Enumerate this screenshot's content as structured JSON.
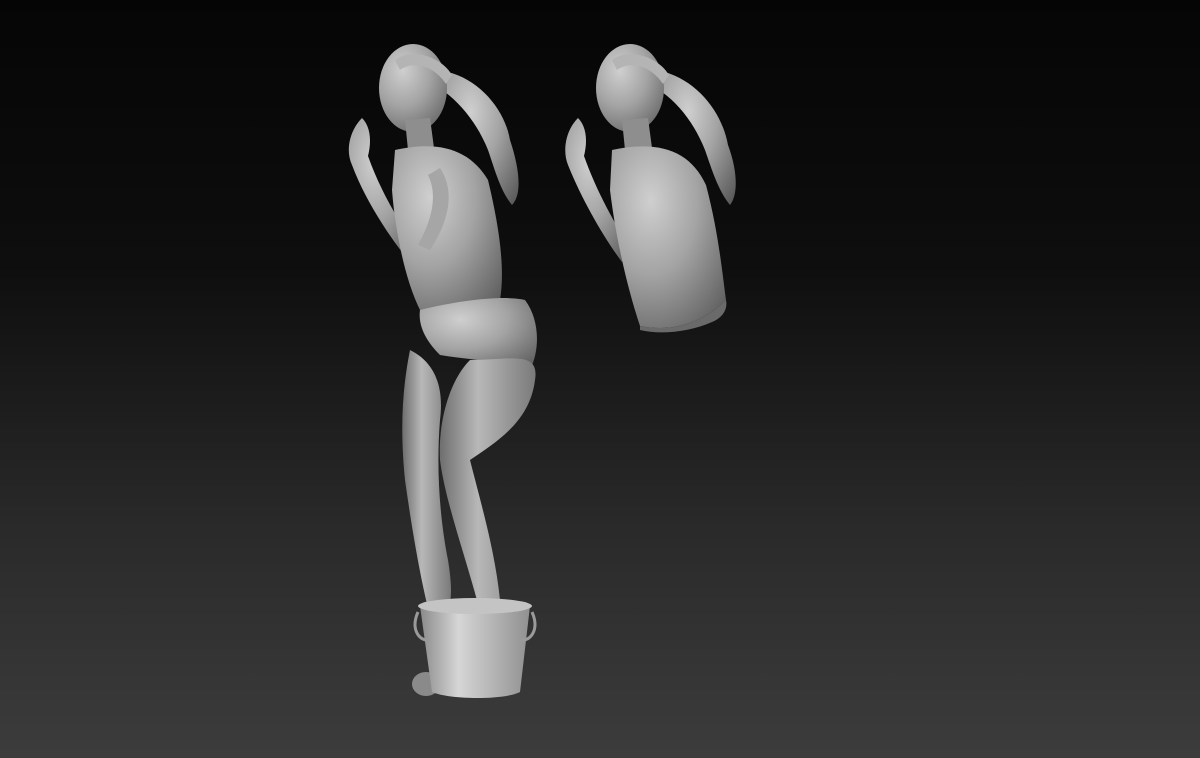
{
  "viewport": {
    "background_top": "#050505",
    "background_bottom": "#3c3c3c",
    "model_color": "#9a9a9a",
    "model_highlight": "#c8c8c8",
    "model_shadow": "#4e4e4e"
  },
  "scene": {
    "objects": [
      {
        "name": "full-figure-sculpt"
      },
      {
        "name": "bucket-prop"
      },
      {
        "name": "torso-bust-sculpt"
      }
    ]
  }
}
